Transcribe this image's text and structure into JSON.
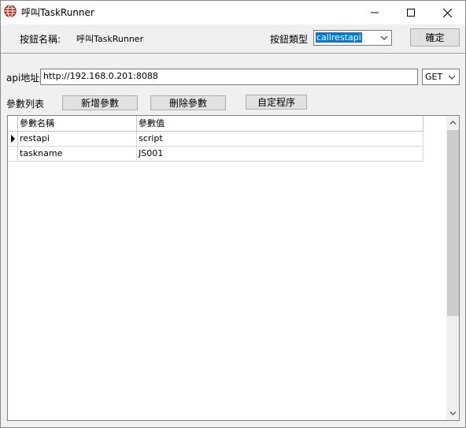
{
  "window": {
    "title": "呼叫TaskRunner"
  },
  "header": {
    "button_name_label": "按鈕名稱:",
    "button_name_value": "呼叫TaskRunner",
    "button_type_label": "按鈕類型",
    "button_type_value": "callrestapi",
    "ok_label": "確定"
  },
  "api": {
    "label": "api地址",
    "url": "http://192.168.0.201:8088",
    "method": "GET"
  },
  "params": {
    "label": "參數列表",
    "add_label": "新增參數",
    "delete_label": "刪除參數",
    "custom_label": "自定程序"
  },
  "grid": {
    "columns": [
      "參數名稱",
      "參數值"
    ],
    "rows": [
      {
        "name": "restapi",
        "value": "script",
        "current": true
      },
      {
        "name": "taskname",
        "value": "JS001",
        "current": false
      }
    ]
  },
  "colors": {
    "selection": "#0078d7",
    "app_icon": "#c0392b"
  }
}
